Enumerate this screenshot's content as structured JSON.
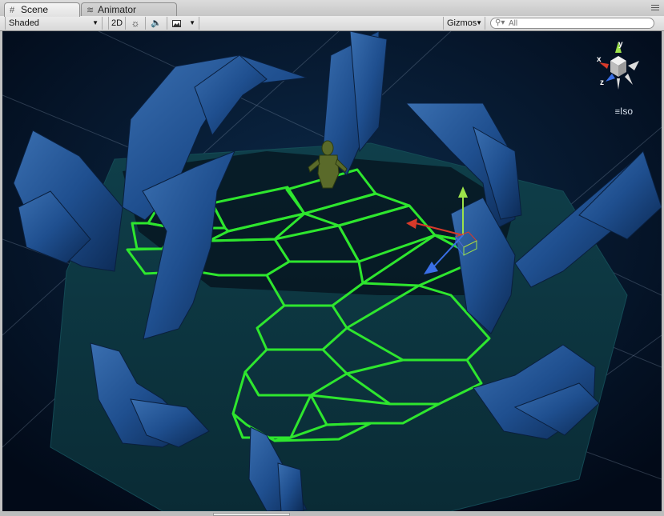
{
  "tabs": [
    {
      "label": "Scene",
      "icon": "grid-icon",
      "active": true
    },
    {
      "label": "Animator",
      "icon": "animator-icon",
      "active": false
    }
  ],
  "toolbar": {
    "draw_mode": "Shaded",
    "mode_2d": "2D",
    "lighting_icon": "sun-icon",
    "audio_icon": "speaker-icon",
    "effects_icon": "image-icon",
    "gizmos_label": "Gizmos",
    "search_placeholder": "All"
  },
  "gizmo": {
    "axis_x": "x",
    "axis_y": "y",
    "axis_z": "z",
    "projection_label": "Iso"
  },
  "colors": {
    "hex_grid": "#2ee62e",
    "background": "#05142a",
    "crystal": "#1e4f8f",
    "axis_x": "#d83a2a",
    "axis_y": "#9ce24a",
    "axis_z": "#3a6fe6"
  }
}
